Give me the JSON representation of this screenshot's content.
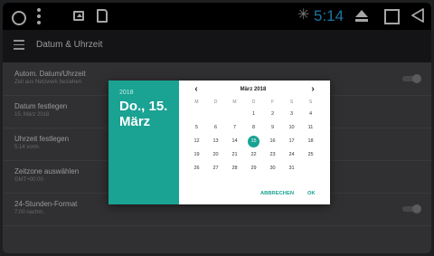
{
  "statusbar": {
    "time": "5:14",
    "bluetooth_glyph": "✳"
  },
  "appbar": {
    "title": "Datum & Uhrzeit"
  },
  "settings": [
    {
      "title": "Autom. Datum/Uhrzeit",
      "subtitle": "Zeit aus Netzwerk beziehen",
      "toggle": true
    },
    {
      "title": "Datum festlegen",
      "subtitle": "15. März 2018"
    },
    {
      "title": "Uhrzeit festlegen",
      "subtitle": "5:14 vorm."
    },
    {
      "title": "Zeitzone auswählen",
      "subtitle": "GMT+00:00"
    },
    {
      "title": "24-Stunden-Format",
      "subtitle": "7:00 nachm.",
      "toggle": true
    }
  ],
  "datepicker": {
    "year": "2018",
    "date_label": "Do., 15. März",
    "month_label": "März 2018",
    "prev": "‹",
    "next": "›",
    "weekdays": [
      "M",
      "D",
      "M",
      "D",
      "F",
      "S",
      "S"
    ],
    "weeks": [
      [
        "",
        "",
        "",
        "1",
        "2",
        "3",
        "4"
      ],
      [
        "5",
        "6",
        "7",
        "8",
        "9",
        "10",
        "11"
      ],
      [
        "12",
        "13",
        "14",
        "15",
        "16",
        "17",
        "18"
      ],
      [
        "19",
        "20",
        "21",
        "22",
        "23",
        "24",
        "25"
      ],
      [
        "26",
        "27",
        "28",
        "29",
        "30",
        "31",
        ""
      ]
    ],
    "selected_day": "15",
    "cancel_label": "ABBRECHEN",
    "ok_label": "OK",
    "accent_color": "#1aa293"
  }
}
